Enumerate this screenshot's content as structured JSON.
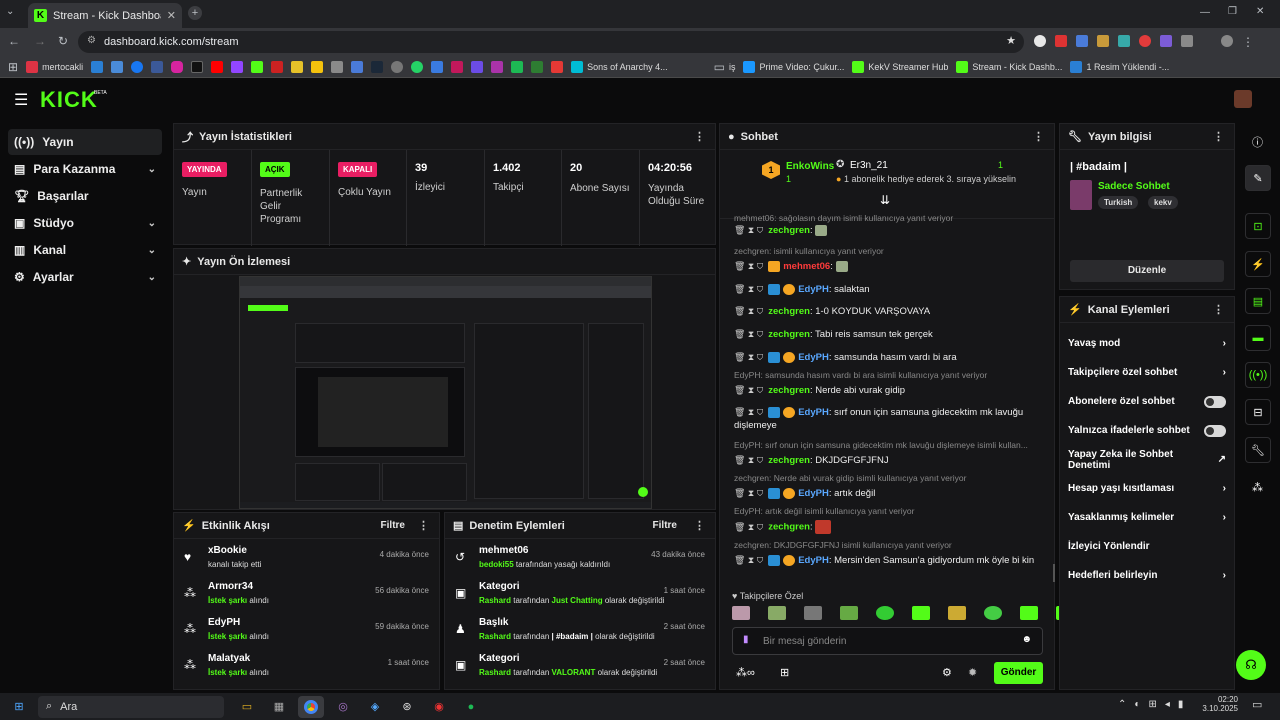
{
  "browser": {
    "tab_title": "Stream - Kick Dashboard",
    "url": "dashboard.kick.com/stream",
    "bookmarks": [
      "mertocakli",
      "Sons of Anarchy 4...",
      "iş",
      "Prime Video: Çukur...",
      "KekV Streamer Hub",
      "Stream - Kick Dashb...",
      "1 Resim Yüklendi -..."
    ]
  },
  "brand": {
    "logo": "KICK",
    "beta": "BETA",
    "accent": "#53fc18"
  },
  "sidebar": {
    "items": [
      {
        "label": "Yayın",
        "icon": "broadcast-icon"
      },
      {
        "label": "Para Kazanma",
        "icon": "money-icon"
      },
      {
        "label": "Başarılar",
        "icon": "trophy-icon"
      },
      {
        "label": "Stüdyo",
        "icon": "studio-icon"
      },
      {
        "label": "Kanal",
        "icon": "channel-icon"
      },
      {
        "label": "Ayarlar",
        "icon": "gear-icon"
      }
    ]
  },
  "stats": {
    "title": "Yayın İstatistikleri",
    "cells": [
      {
        "badge": "YAYINDA",
        "label": "Yayın"
      },
      {
        "badge": "AÇIK",
        "label": "Partnerlik Gelir Programı"
      },
      {
        "badge": "KAPALI",
        "label": "Çoklu Yayın"
      },
      {
        "value": "39",
        "label": "İzleyici"
      },
      {
        "value": "1.402",
        "label": "Takipçi"
      },
      {
        "value": "20",
        "label": "Abone Sayısı"
      },
      {
        "value": "04:20:56",
        "label": "Yayında Olduğu Süre"
      }
    ]
  },
  "preview": {
    "title": "Yayın Ön İzlemesi"
  },
  "activity": {
    "title": "Etkinlik Akışı",
    "filter": "Filtre",
    "items": [
      {
        "name": "xBookie",
        "desc": "kanalı takip etti",
        "time": "4 dakika önce"
      },
      {
        "name": "Armorr34",
        "hl": "İstek şarkı",
        "desc": " alındı",
        "time": "56 dakika önce"
      },
      {
        "name": "EdyPH",
        "hl": "İstek şarkı",
        "desc": " alındı",
        "time": "59 dakika önce"
      },
      {
        "name": "Malatyak",
        "hl": "İstek şarkı",
        "desc": " alındı",
        "time": "1 saat önce"
      }
    ]
  },
  "moderation": {
    "title": "Denetim Eylemleri",
    "filter": "Filtre",
    "items": [
      {
        "name": "mehmet06",
        "hl": "bedoki55",
        "desc": " tarafından yasağı kaldırıldı",
        "time": "43 dakika önce"
      },
      {
        "name": "Kategori",
        "hl": "Rashard",
        "desc": " tarafından ",
        "hl2": "Just Chatting",
        "desc2": " olarak değiştirildi",
        "time": "1 saat önce"
      },
      {
        "name": "Başlık",
        "hl": "Rashard",
        "desc": " tarafından ",
        "hl2": "| #badaim |",
        "desc2": " olarak değiştirildi",
        "time": "2 saat önce"
      },
      {
        "name": "Kategori",
        "hl": "Rashard",
        "desc": " tarafından ",
        "hl2": "VALORANT",
        "desc2": " olarak değiştirildi",
        "time": "2 saat önce"
      }
    ]
  },
  "chat": {
    "title": "Sohbet",
    "pinned": {
      "user1": "EnkoWins",
      "count1": "1",
      "user2": "Er3n_21",
      "count2": "1",
      "gift": "1 abonelik hediye ederek 3. sıraya yükselin"
    },
    "messages": [
      {
        "reply": "mehmet06: sağolasın dayım isimli kullanıcıya yanıt veriyor"
      },
      {
        "user": "zechgren",
        "text": "",
        "color": "#53fc18"
      },
      {
        "reply": "zechgren: isimli kullanıcıya yanıt veriyor"
      },
      {
        "user": "mehmet06",
        "text": "",
        "color": "#ff3b3b"
      },
      {
        "user": "EdyPH",
        "text": "salaktan",
        "color": "#5aa8ff"
      },
      {
        "user": "zechgren",
        "text": "1-0 KOYDUK VARŞOVAYA",
        "color": "#53fc18"
      },
      {
        "user": "zechgren",
        "text": "Tabi reis samsun tek gerçek",
        "color": "#53fc18"
      },
      {
        "user": "EdyPH",
        "text": "samsunda hasım vardı bi ara",
        "color": "#5aa8ff"
      },
      {
        "reply": "EdyPH: samsunda hasım vardı bi ara isimli kullanıcıya yanıt veriyor"
      },
      {
        "user": "zechgren",
        "text": "Nerde abi vurak gidip",
        "color": "#53fc18"
      },
      {
        "user": "EdyPH",
        "text": "sırf onun için samsuna gidecektim mk lavuğu dişlemeye",
        "color": "#5aa8ff"
      },
      {
        "reply": "EdyPH: sırf onun için samsuna gidecektim mk lavuğu dişlemeye isimli kullan..."
      },
      {
        "user": "zechgren",
        "text": "DKJDGFGFJFNJ",
        "color": "#53fc18"
      },
      {
        "reply": "zechgren: Nerde abi vurak gidip isimli kullanıcıya yanıt veriyor"
      },
      {
        "user": "EdyPH",
        "text": "artık değil",
        "color": "#5aa8ff"
      },
      {
        "reply": "EdyPH: artık değil isimli kullanıcıya yanıt veriyor"
      },
      {
        "user": "zechgren",
        "text": "",
        "color": "#53fc18"
      },
      {
        "reply": "zechgren: DKJDGFGFJFNJ isimli kullanıcıya yanıt veriyor"
      },
      {
        "user": "EdyPH",
        "text": "Mersin'den Samsun'a gidiyordum mk öyle bi kin",
        "color": "#5aa8ff"
      }
    ],
    "emote_label": "Takipçilere Özel",
    "placeholder": "Bir mesaj gönderin",
    "send": "Gönder"
  },
  "info": {
    "title": "Yayın bilgisi",
    "stream_title": "| #badaim |",
    "category": "Sadece Sohbet",
    "tags": [
      "Turkish",
      "kekv"
    ],
    "edit": "Düzenle"
  },
  "actions": {
    "title": "Kanal Eylemleri",
    "items": [
      {
        "label": "Yavaş mod",
        "ctl": "chevron"
      },
      {
        "label": "Takipçilere özel sohbet",
        "ctl": "chevron"
      },
      {
        "label": "Abonelere özel sohbet",
        "ctl": "toggle"
      },
      {
        "label": "Yalnızca ifadelerle sohbet",
        "ctl": "toggle"
      },
      {
        "label": "Yapay Zeka ile Sohbet Denetimi",
        "ctl": "external"
      },
      {
        "label": "Hesap yaşı kısıtlaması",
        "ctl": "chevron"
      },
      {
        "label": "Yasaklanmış kelimeler",
        "ctl": "chevron"
      },
      {
        "label": "İzleyici Yönlendir",
        "ctl": "none"
      },
      {
        "label": "Hedefleri belirleyin",
        "ctl": "chevron"
      }
    ]
  },
  "taskbar": {
    "search": "Ara",
    "time": "02:20",
    "date": "3.10.2025"
  }
}
